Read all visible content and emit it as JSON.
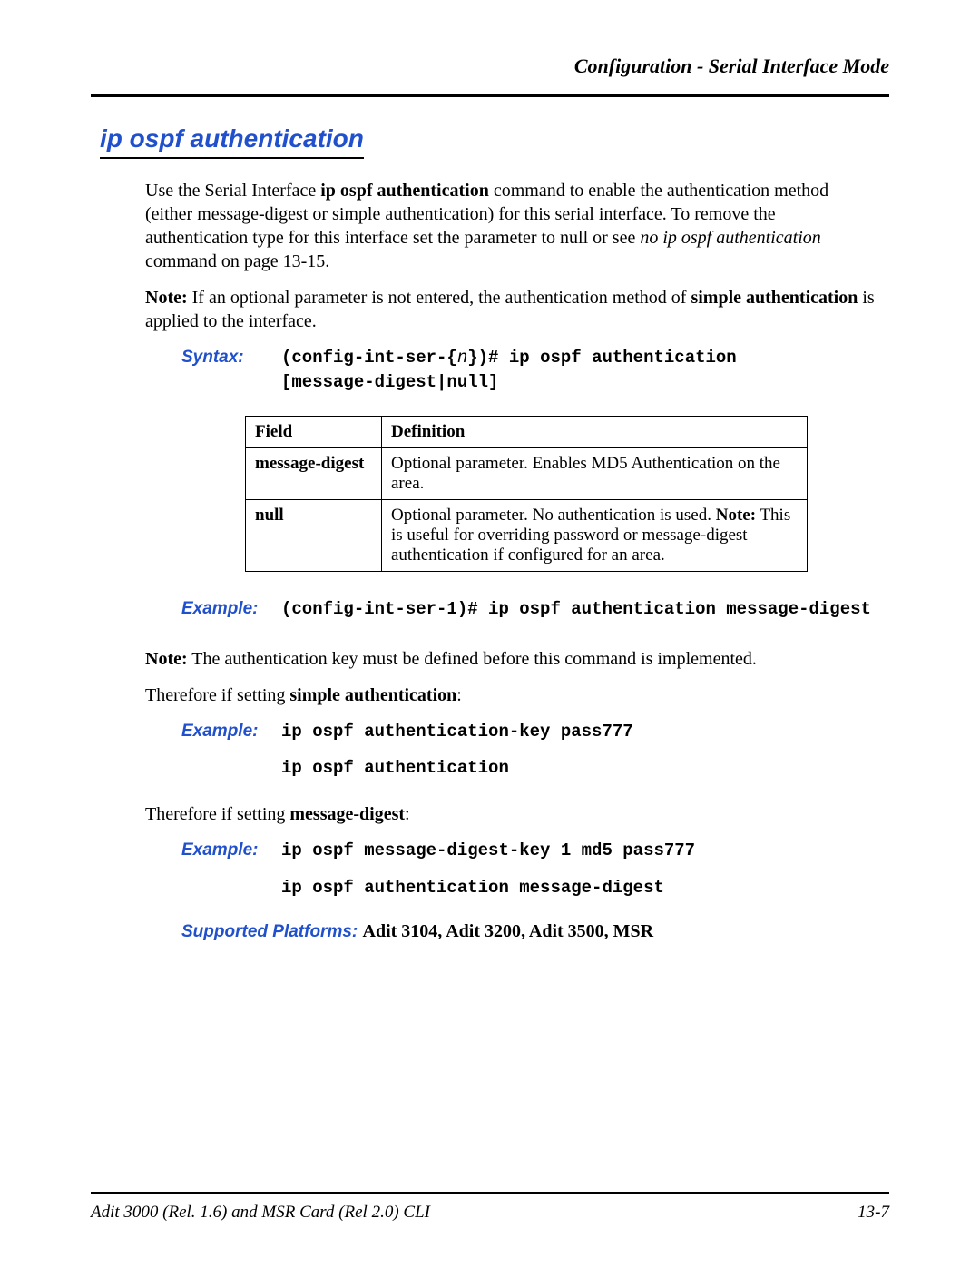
{
  "header": "Configuration - Serial Interface Mode",
  "title": "ip ospf authentication",
  "intro": {
    "p1_a": "Use the Serial Interface ",
    "p1_b": "ip ospf authentication",
    "p1_c": " command to enable the authentication method  (either message-digest or simple authentication) for this serial interface. To remove the authentication type for this interface set the parameter to null or see ",
    "p1_d": "no ip ospf authentication",
    "p1_e": " command on page 13-15.",
    "p2_a": "Note:",
    "p2_b": " If an optional parameter is not entered, the authentication method of ",
    "p2_c": "simple authentication",
    "p2_d": " is applied to the interface."
  },
  "syntax": {
    "label": "Syntax:",
    "line1a": "(config-int-ser-{",
    "line1b": "n",
    "line1c": "})# ip ospf authentication",
    "line2": "[message-digest|null]"
  },
  "table": {
    "h1": "Field",
    "h2": "Definition",
    "rows": [
      {
        "field": "message-digest",
        "def": "Optional parameter. Enables MD5 Authentication on the area."
      },
      {
        "field": "null",
        "def_a": "Optional parameter. No authentication is used. ",
        "def_b": "Note:",
        "def_c": " This is useful for overriding password or message-digest authentication  if configured for an area."
      }
    ]
  },
  "example1": {
    "label": "Example:",
    "text": "(config-int-ser-1)# ip ospf authentication message-digest"
  },
  "note2_a": "Note:",
  "note2_b": " The authentication key must be defined before this command is implemented.",
  "therefore1_a": "Therefore if setting ",
  "therefore1_b": "simple authentication",
  "therefore1_c": ":",
  "example2": {
    "label": "Example:",
    "l1": "ip ospf authentication-key pass777",
    "l2": "ip ospf authentication"
  },
  "therefore2_a": "Therefore if setting ",
  "therefore2_b": "message-digest",
  "therefore2_c": ":",
  "example3": {
    "label": "Example:",
    "l1": "ip ospf message-digest-key 1 md5 pass777",
    "l2": "ip ospf authentication message-digest"
  },
  "supported": {
    "label": "Supported Platforms:  ",
    "value": "Adit 3104, Adit 3200, Adit 3500, MSR"
  },
  "footer": {
    "left": "Adit 3000 (Rel. 1.6) and MSR Card (Rel 2.0) CLI",
    "right": "13-7"
  }
}
